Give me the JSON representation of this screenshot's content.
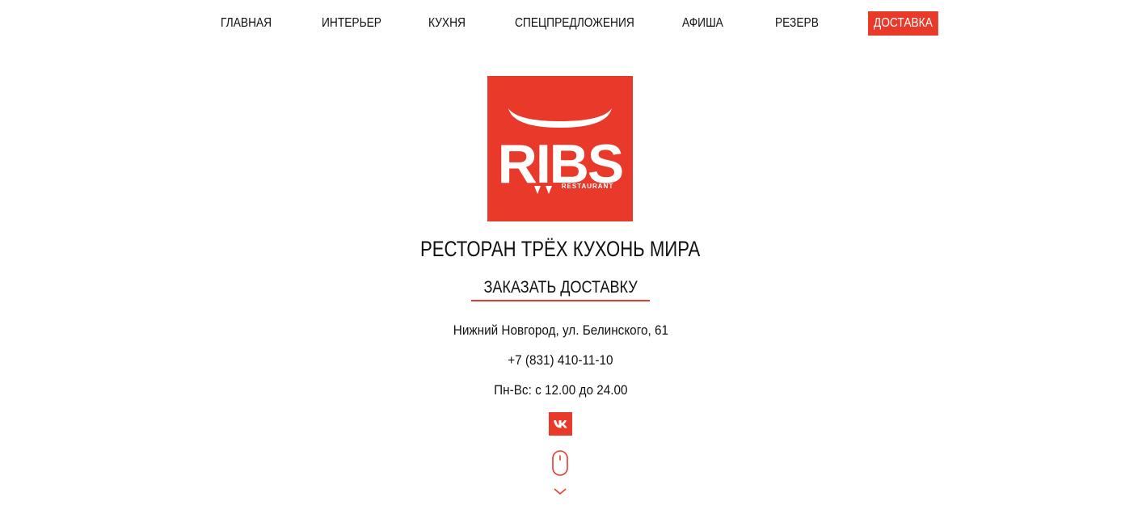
{
  "nav": {
    "items": [
      {
        "label": "ГЛАВНАЯ"
      },
      {
        "label": "ИНТЕРЬЕР"
      },
      {
        "label": "КУХНЯ"
      },
      {
        "label": "СПЕЦПРЕДЛОЖЕНИЯ"
      },
      {
        "label": "АФИША"
      },
      {
        "label": "РЕЗЕРВ"
      },
      {
        "label": "ДОСТАВКА",
        "active": true
      }
    ]
  },
  "logo": {
    "text": "RIBS",
    "subtext": "RESTAURANT"
  },
  "hero": {
    "headline": "РЕСТОРАН ТРЁХ КУХОНЬ МИРА",
    "cta_label": "ЗАКАЗАТЬ ДОСТАВКУ"
  },
  "contacts": {
    "address": "Нижний Новгород, ул. Белинского, 61",
    "phone": "+7 (831) 410-11-10",
    "hours": "Пн-Вс: с 12.00 до 24.00"
  },
  "social": {
    "vk_icon": "vk-icon"
  },
  "scroll": {
    "icons": [
      "mouse-icon",
      "chevron-down-icon"
    ]
  },
  "colors": {
    "accent": "#e8392a",
    "text": "#111111",
    "background": "#ffffff"
  }
}
